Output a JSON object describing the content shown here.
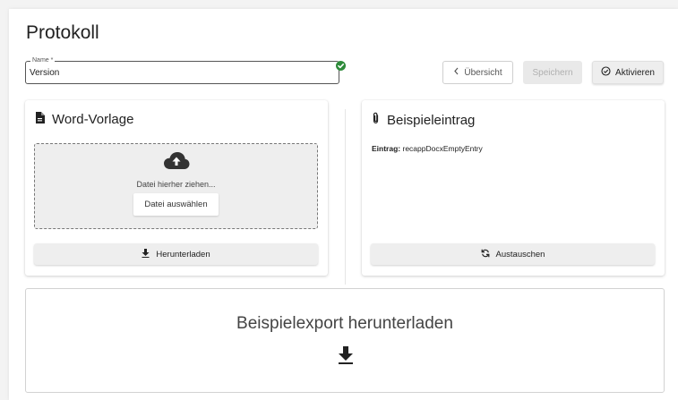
{
  "page": {
    "title": "Protokoll"
  },
  "name_field": {
    "label": "Name *",
    "value": "Version"
  },
  "toolbar": {
    "overview_label": "Übersicht",
    "save_label": "Speichern",
    "activate_label": "Aktivieren"
  },
  "word_card": {
    "title": "Word-Vorlage",
    "drop_text": "Datei hierher ziehen...",
    "select_file_label": "Datei auswählen",
    "download_label": "Herunterladen"
  },
  "example_card": {
    "title": "Beispieleintrag",
    "entry_label": "Eintrag:",
    "entry_value": "recappDocxEmptyEntry",
    "replace_label": "Austauschen"
  },
  "export": {
    "label": "Beispielexport herunterladen"
  },
  "colors": {
    "success": "#2e8b3b",
    "dropzone_bg": "#eeeeee"
  }
}
